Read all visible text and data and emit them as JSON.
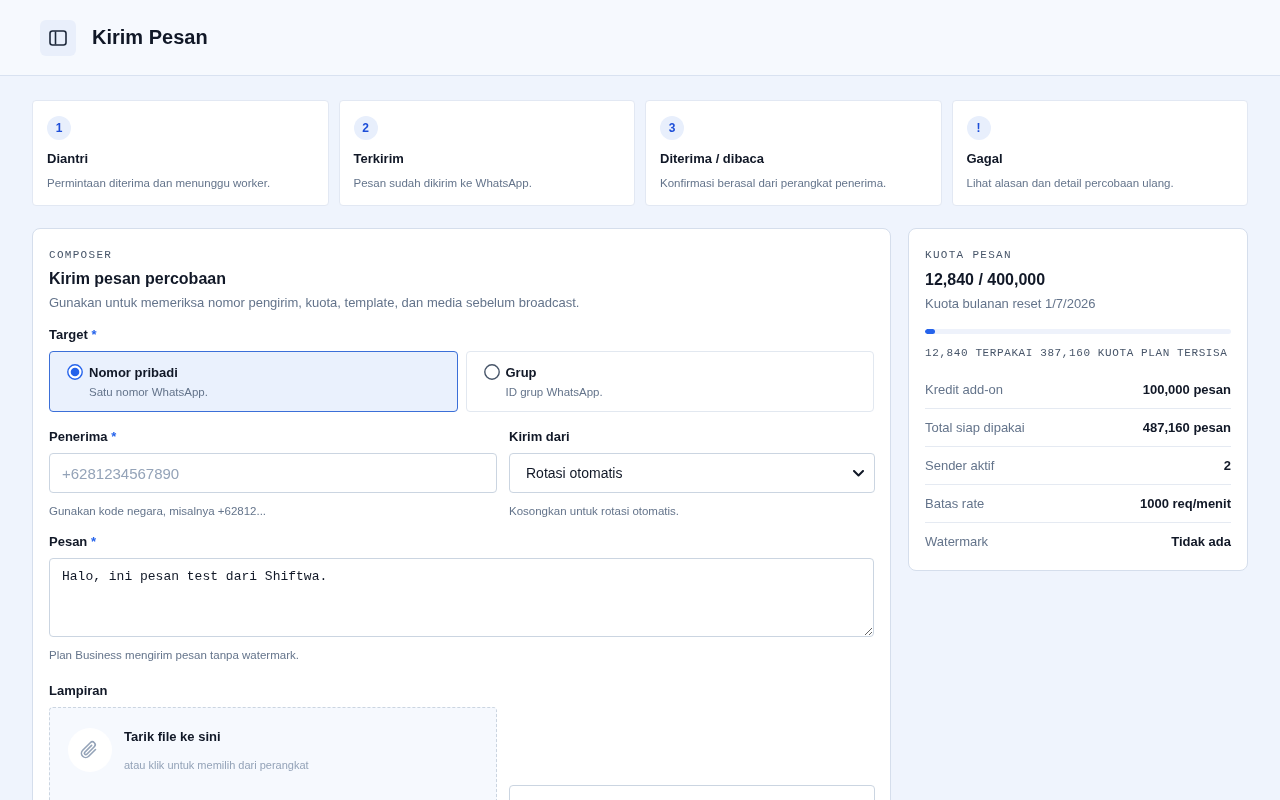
{
  "header": {
    "title": "Kirim Pesan"
  },
  "steps": [
    {
      "badge": "1",
      "title": "Diantri",
      "description": "Permintaan diterima dan menunggu worker."
    },
    {
      "badge": "2",
      "title": "Terkirim",
      "description": "Pesan sudah dikirim ke WhatsApp."
    },
    {
      "badge": "3",
      "title": "Diterima / dibaca",
      "description": "Konfirmasi berasal dari perangkat penerima."
    },
    {
      "badge": "!",
      "title": "Gagal",
      "description": "Lihat alasan dan detail percobaan ulang."
    }
  ],
  "composer": {
    "eyebrow": "COMPOSER",
    "title": "Kirim pesan percobaan",
    "description": "Gunakan untuk memeriksa nomor pengirim, kuota, template, dan media sebelum broadcast.",
    "target": {
      "label": "Target",
      "required_mark": "*",
      "options": [
        {
          "label": "Nomor pribadi",
          "description": "Satu nomor WhatsApp.",
          "selected": true
        },
        {
          "label": "Grup",
          "description": "ID grup WhatsApp.",
          "selected": false
        }
      ]
    },
    "recipient": {
      "label": "Penerima",
      "required_mark": "*",
      "placeholder": "+6281234567890",
      "help": "Gunakan kode negara, misalnya +62812..."
    },
    "sender": {
      "label": "Kirim dari",
      "value": "Rotasi otomatis",
      "help": "Kosongkan untuk rotasi otomatis."
    },
    "message": {
      "label": "Pesan",
      "required_mark": "*",
      "value": "Halo, ini pesan test dari Shiftwa.",
      "help": "Plan Business mengirim pesan tanpa watermark."
    },
    "attachment": {
      "label": "Lampiran",
      "title": "Tarik file ke sini",
      "hint": "atau klik untuk memilih dari perangkat"
    }
  },
  "quota": {
    "eyebrow": "KUOTA PESAN",
    "value": "12,840 / 400,000",
    "subtitle": "Kuota bulanan reset 1/7/2026",
    "level": 0.032,
    "usage": "12,840 TERPAKAI 387,160 KUOTA PLAN TERSISA",
    "rows": [
      {
        "label": "Kredit add-on",
        "value": "100,000 pesan"
      },
      {
        "label": "Total siap dipakai",
        "value": "487,160 pesan"
      },
      {
        "label": "Sender aktif",
        "value": "2"
      },
      {
        "label": "Batas rate",
        "value": "1000 req/menit"
      },
      {
        "label": "Watermark",
        "value": "Tidak ada"
      }
    ]
  }
}
